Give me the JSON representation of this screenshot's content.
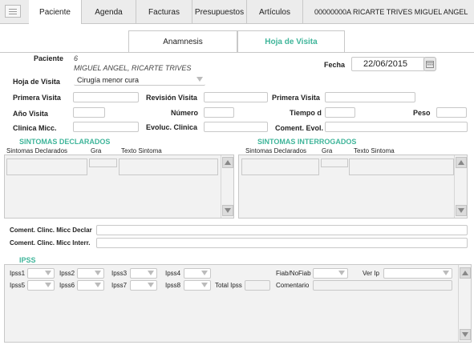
{
  "tabs": [
    "Paciente",
    "Agenda",
    "Facturas",
    "Presupuestos",
    "Artículos"
  ],
  "patient_header": "00000000A RICARTE TRIVES MIGUEL ANGEL",
  "subtabs": [
    "Anamnesis",
    "Hoja de Visita"
  ],
  "form": {
    "paciente_label": "Paciente",
    "paciente_num": "6",
    "paciente_name": "MIGUEL ANGEL, RICARTE TRIVES",
    "fecha_label": "Fecha",
    "fecha_value": "22/06/2015",
    "hoja_label": "Hoja de Visita",
    "hoja_value": "Cirugía menor cura",
    "primera_visita_label": "Primera Visita",
    "revision_visita_label": "Revisión Visita",
    "primera_visita2_label": "Primera Visita",
    "ano_visita_label": "Año Visita",
    "numero_label": "Número",
    "tiempo_label": "Tiempo d",
    "peso_label": "Peso",
    "clinica_label": "Clinica Micc.",
    "evoluc_label": "Evoluc. Clinica",
    "coment_evol_label": "Coment. Evol."
  },
  "sintomas_declarados": {
    "title": "SINTOMAS DECLARADOS",
    "columns": [
      "Sintomas Declarados",
      "Gra",
      "Texto Sintoma"
    ]
  },
  "sintomas_interrogados": {
    "title": "SINTOMAS INTERROGADOS",
    "columns": [
      "Sintomas Declarados",
      "Gra",
      "Texto Sintoma"
    ]
  },
  "coment_declar_label": "Coment. Clinc. Micc Declar",
  "coment_interr_label": "Coment. Clinc. Micc Interr.",
  "ipss": {
    "title": "IPSS",
    "row1": [
      "Ipss1",
      "Ipss2",
      "Ipss3",
      "Ipss4"
    ],
    "row2": [
      "Ipss5",
      "Ipss6",
      "Ipss7",
      "Ipss8"
    ],
    "fiab_label": "Fiab/NoFiab",
    "verip_label": "Ver Ip",
    "total_label": "Total Ipss",
    "comentario_label": "Comentario"
  },
  "colors": {
    "accent": "#3fb59a",
    "border": "#c8c8c8",
    "panel": "#f2f2f2"
  },
  "icons": {
    "menu": "menu-icon",
    "calendar": "calendar-icon"
  }
}
